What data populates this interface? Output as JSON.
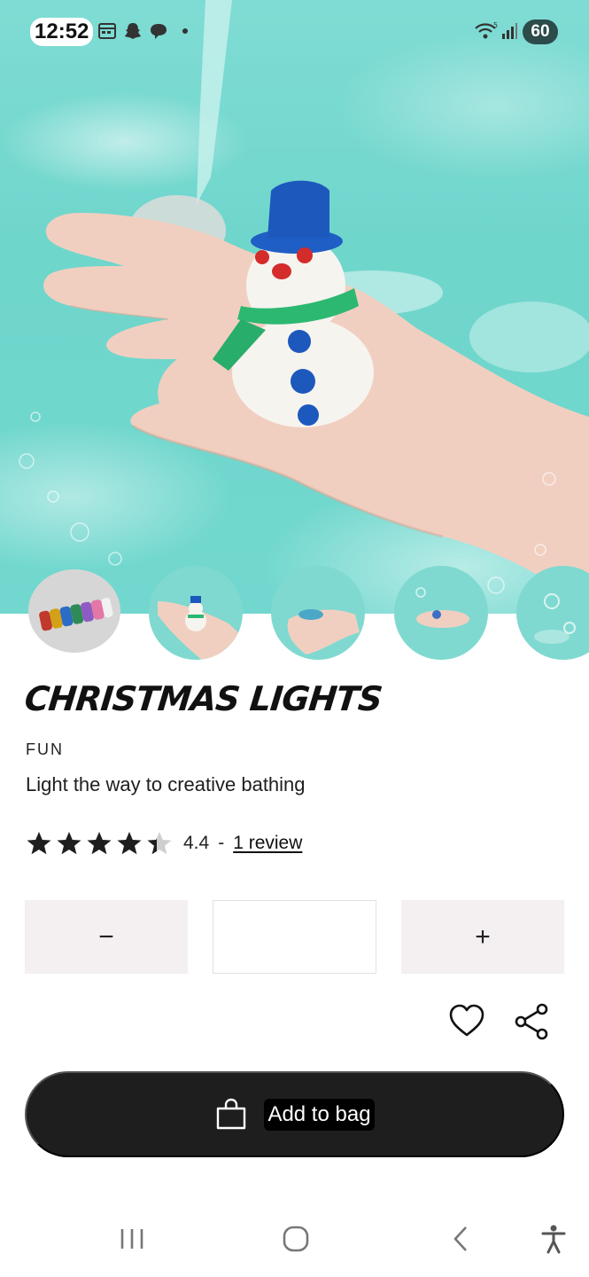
{
  "status_bar": {
    "time": "12:52",
    "battery": "60",
    "icons": [
      "calendar-icon",
      "snapchat-icon",
      "chat-bubble-icon",
      "dot-icon",
      "wifi-icon",
      "signal-icon"
    ]
  },
  "hero": {
    "image": "snowman-bath-bomb-in-hand-over-water"
  },
  "thumbnails": [
    {
      "name": "christmas-lights-product-roll"
    },
    {
      "name": "snowman-in-hand"
    },
    {
      "name": "hands-in-water"
    },
    {
      "name": "hand-in-bubbles"
    },
    {
      "name": "water-foam"
    }
  ],
  "product": {
    "title": "CHRISTMAS LIGHTS",
    "category": "FUN",
    "tagline": "Light the way to creative bathing",
    "rating": 4.4,
    "rating_text": "4.4",
    "separator": "-",
    "review_link": "1 review"
  },
  "quantity": {
    "minus_label": "−",
    "plus_label": "+",
    "value": ""
  },
  "actions": {
    "favorite_icon": "heart-icon",
    "share_icon": "share-icon"
  },
  "add_to_bag": {
    "label": "Add to bag",
    "icon": "shopping-bag-icon"
  },
  "nav_bar": {
    "icons": [
      "recent-apps-icon",
      "home-icon",
      "back-icon",
      "accessibility-icon"
    ]
  },
  "colors": {
    "water": "#72d8cf",
    "button_dark": "#1e1e1e",
    "qty_bg": "#f4eff1"
  }
}
